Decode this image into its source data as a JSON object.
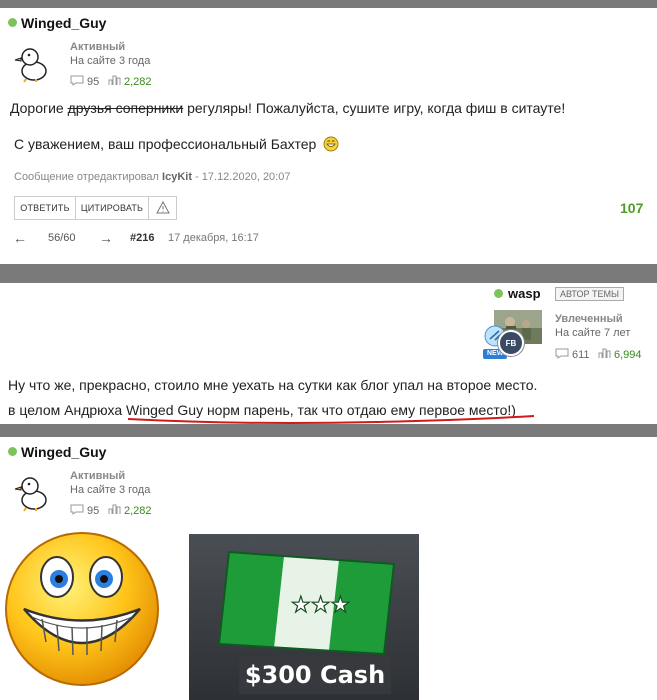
{
  "post1": {
    "username": "Winged_Guy",
    "rank": "Активный",
    "since": "На сайте 3 года",
    "comments": "95",
    "rating": "2,282",
    "text_prefix": "Дорогие ",
    "text_strike": "друзья соперники",
    "text_suffix": " регуляры! Пожалуйста, сушите игру, когда фиш в ситауте!",
    "signature": "С уважением, ваш профессиональный Бахтер",
    "edited_prefix": "Сообщение отредактировал ",
    "edited_user": "IcyKit",
    "edited_suffix": " - 17.12.2020, 20:07",
    "reply_label": "ОТВЕТИТЬ",
    "quote_label": "ЦИТИРОВАТЬ",
    "score": "107",
    "page": "56/60",
    "post_number": "#216",
    "date": "17 декабря, 16:17"
  },
  "post2": {
    "username": "wasp",
    "author_badge": "АВТОР ТЕМЫ",
    "rank": "Увлеченный",
    "since": "На сайте 7 лет",
    "comments": "611",
    "rating": "6,994",
    "new_badge": "NEW",
    "avatar_badge": "FB",
    "line1": "Ну что же, прекрасно, стоило мне уехать на сутки  как блог упал на второе место.",
    "line2_prefix": "в целом Андрюха ",
    "line2_underlined": "Winged Guy норм парень, так что отдаю ему первое место!)"
  },
  "post3": {
    "username": "Winged_Guy",
    "rank": "Активный",
    "since": "На сайте 3 года",
    "comments": "95",
    "rating": "2,282",
    "cash_label": "$300 Cash"
  },
  "colors": {
    "online": "#7cc35a",
    "score": "#4e9a2a",
    "separator": "#7a7a7a",
    "underline": "#d11a1a"
  }
}
